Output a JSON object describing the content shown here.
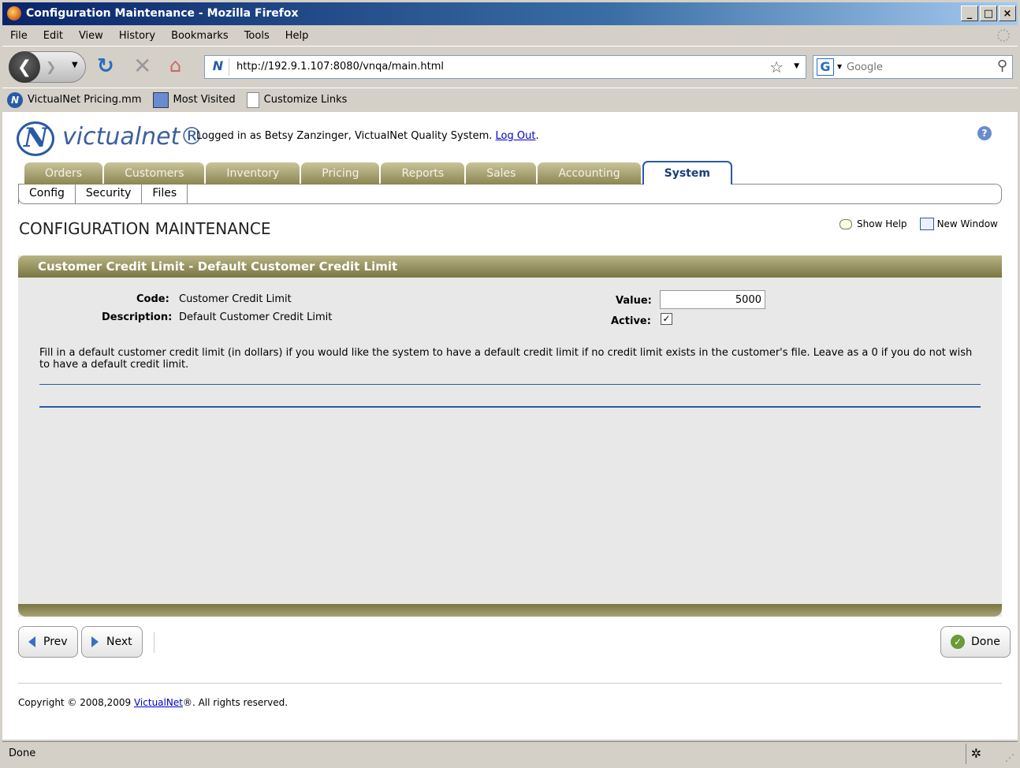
{
  "window": {
    "title": "Configuration Maintenance - Mozilla Firefox",
    "controls": [
      "_",
      "□",
      "×"
    ]
  },
  "menu": [
    "File",
    "Edit",
    "View",
    "History",
    "Bookmarks",
    "Tools",
    "Help"
  ],
  "navbar": {
    "url": "http://192.9.1.107:8080/vnqa/main.html",
    "search_placeholder": "Google"
  },
  "bookmarks": [
    "VictualNet Pricing.mm",
    "Most Visited",
    "Customize Links"
  ],
  "app": {
    "logo_text": "victualnet®",
    "login_prefix": "Logged in as Betsy Zanzinger, VictualNet Quality System.",
    "logout_label": "Log Out",
    "login_suffix": ".",
    "tabs": [
      {
        "label": "Orders",
        "active": false
      },
      {
        "label": "Customers",
        "active": false
      },
      {
        "label": "Inventory",
        "active": false
      },
      {
        "label": "Pricing",
        "active": false
      },
      {
        "label": "Reports",
        "active": false
      },
      {
        "label": "Sales",
        "active": false
      },
      {
        "label": "Accounting",
        "active": false
      },
      {
        "label": "System",
        "active": true
      }
    ],
    "subtabs": [
      "Config",
      "Security",
      "Files"
    ]
  },
  "page": {
    "title": "CONFIGURATION MAINTENANCE",
    "show_help": "Show Help",
    "new_window": "New Window"
  },
  "panel": {
    "header": "Customer Credit Limit - Default Customer Credit Limit",
    "code_label": "Code:",
    "code_value": "Customer Credit Limit",
    "description_label": "Description:",
    "description_value": "Default Customer Credit Limit",
    "value_label": "Value:",
    "value": "5000",
    "active_label": "Active:",
    "active_mark": "✓",
    "help_text": "Fill in a default customer credit limit (in dollars) if you would like the system to have a default credit limit if no credit limit exists in the customer's file. Leave as a 0 if you do not wish to have a default credit limit."
  },
  "buttons": {
    "prev": "Prev",
    "next": "Next",
    "done": "Done"
  },
  "footer": {
    "prefix": "Copyright © 2008,2009 ",
    "link": "VictualNet",
    "suffix": "®. All rights reserved."
  },
  "status": {
    "text": "Done"
  },
  "colors": {
    "tab_olive": "#8b8652",
    "accent_blue": "#2a5aa5"
  }
}
